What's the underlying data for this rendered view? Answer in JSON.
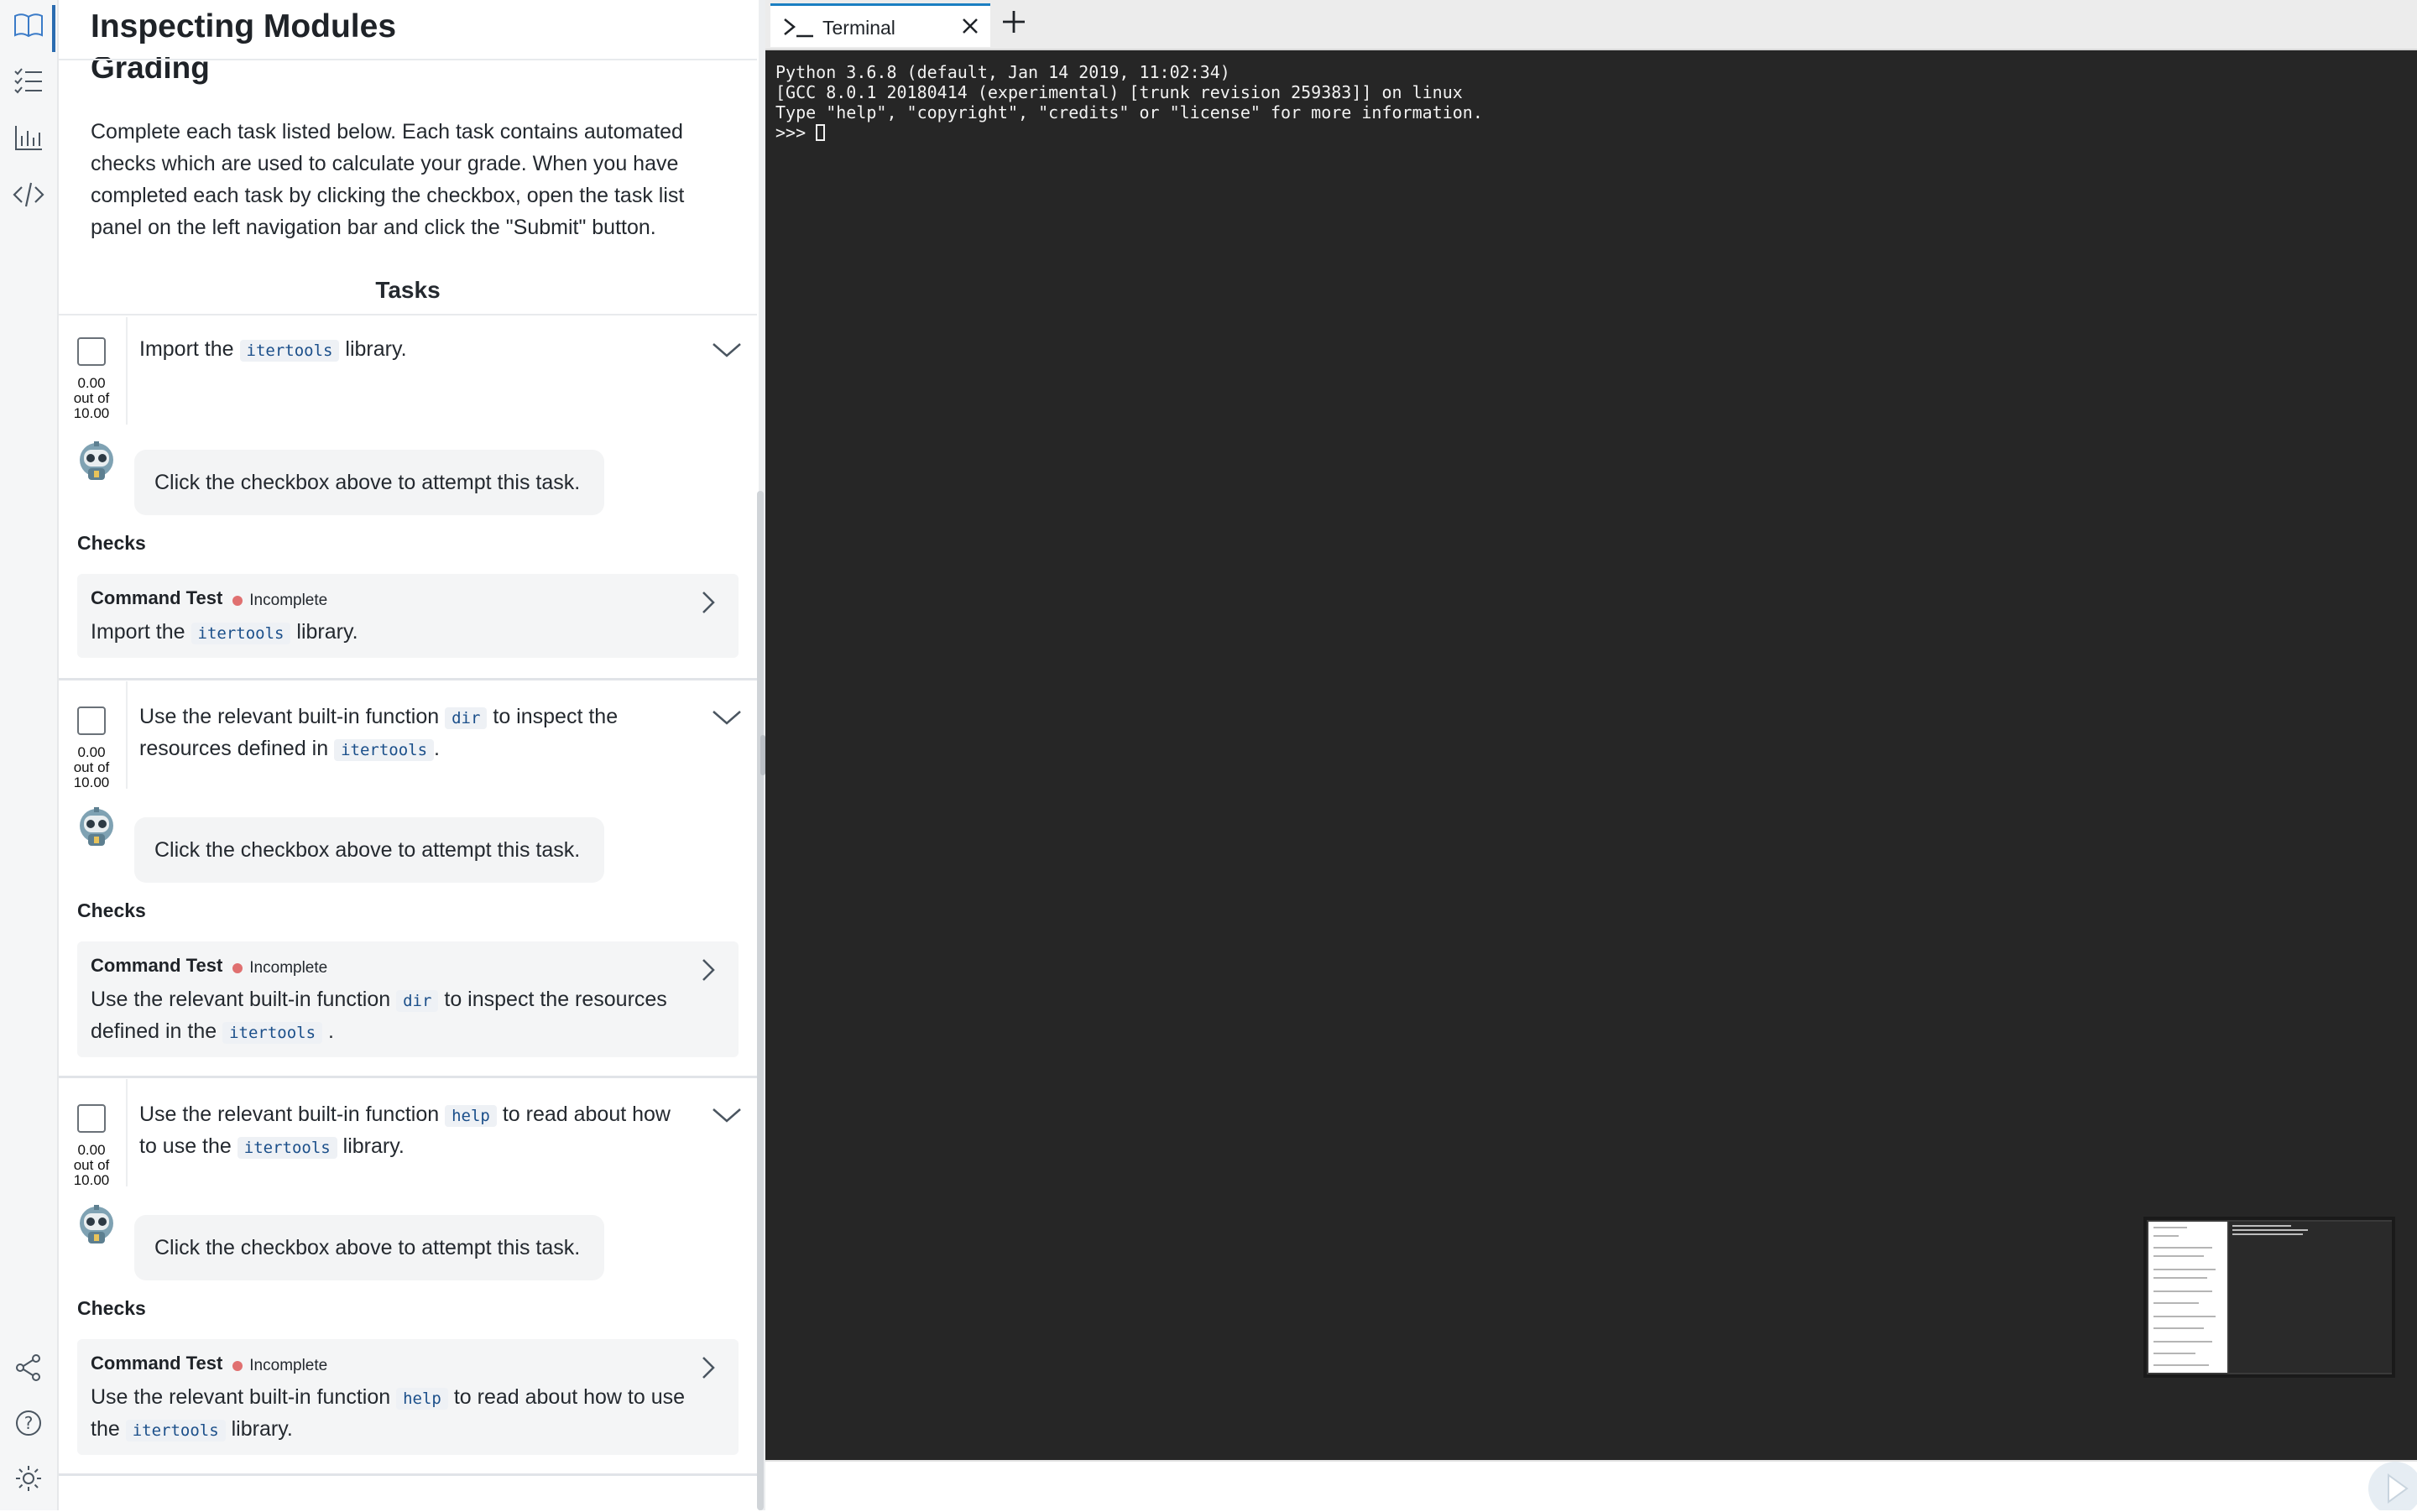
{
  "rail": {
    "icons": [
      "book-open-icon",
      "task-list-icon",
      "bar-chart-icon",
      "code-icon",
      "share-icon",
      "help-icon",
      "settings-icon"
    ]
  },
  "panel": {
    "page_title": "Inspecting Modules",
    "section_heading": "Grading",
    "intro": "Complete each task listed below. Each task contains automated checks which are used to calculate your grade. When you have completed each task by clicking the checkbox, open the task list panel on the left navigation bar and click the \"Submit\" button.",
    "tasks_heading": "Tasks",
    "tasks": [
      {
        "score": "0.00",
        "out_of": "out of",
        "max": "10.00",
        "text_before": "Import the",
        "code1": "itertools",
        "text_mid": "library.",
        "code2": "",
        "text_after": "",
        "bubble": "Click the checkbox above to attempt this task.",
        "checks_label": "Checks",
        "check_title": "Command Test",
        "check_status": "Incomplete",
        "check_before": "Import the",
        "check_code1": "itertools",
        "check_mid": "library.",
        "check_code2": "",
        "check_after": ""
      },
      {
        "score": "0.00",
        "out_of": "out of",
        "max": "10.00",
        "text_before": "Use the relevant built-in function",
        "code1": "dir",
        "text_mid": "to inspect the resources defined in",
        "code2": "itertools",
        "text_after": ".",
        "bubble": "Click the checkbox above to attempt this task.",
        "checks_label": "Checks",
        "check_title": "Command Test",
        "check_status": "Incomplete",
        "check_before": "Use the relevant built-in function",
        "check_code1": "dir",
        "check_mid": "to inspect the resources defined in the",
        "check_code2": "itertools",
        "check_after": "."
      },
      {
        "score": "0.00",
        "out_of": "out of",
        "max": "10.00",
        "text_before": "Use the relevant built-in function",
        "code1": "help",
        "text_mid": "to read about how to use the",
        "code2": "itertools",
        "text_after": "library.",
        "bubble": "Click the checkbox above to attempt this task.",
        "checks_label": "Checks",
        "check_title": "Command Test",
        "check_status": "Incomplete",
        "check_before": "Use the relevant built-in function",
        "check_code1": "help",
        "check_mid": "to read about how to use the",
        "check_code2": "itertools",
        "check_after": "library."
      }
    ]
  },
  "terminal": {
    "tab_label": "Terminal",
    "lines": [
      "Python 3.6.8 (default, Jan 14 2019, 11:02:34)",
      "[GCC 8.0.1 20180414 (experimental) [trunk revision 259383]] on linux",
      "Type \"help\", \"copyright\", \"credits\" or \"license\" for more information."
    ],
    "prompt": ">>> "
  },
  "colors": {
    "accent": "#2b6cb0",
    "incomplete_dot": "#e07070",
    "terminal_bg": "#262626",
    "code_text": "#1b4f8a"
  }
}
